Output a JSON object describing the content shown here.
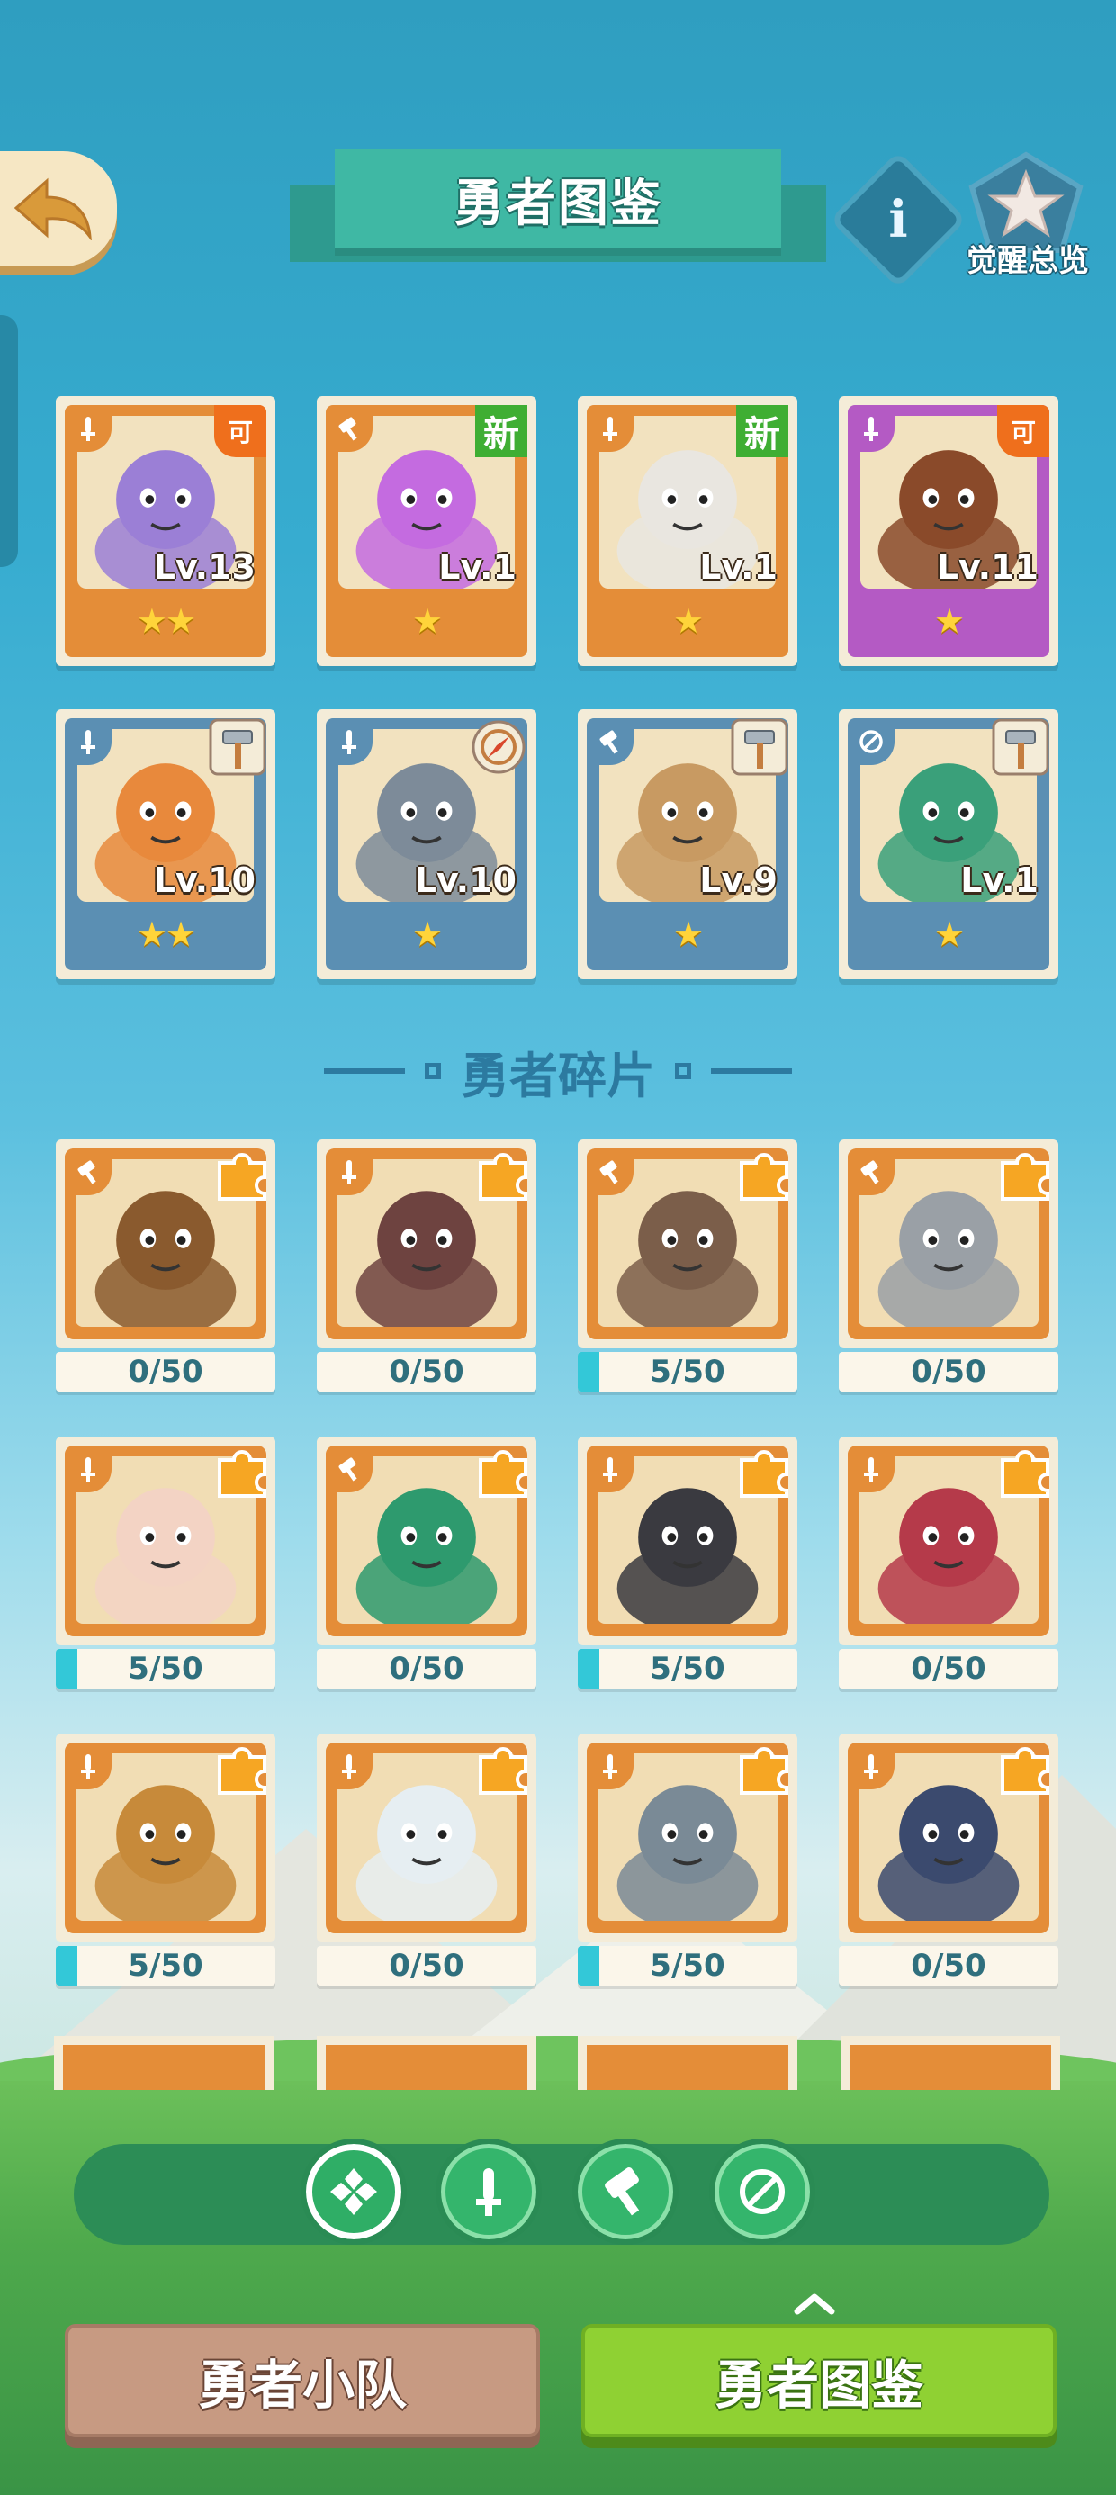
{
  "header": {
    "title": "勇者图鉴",
    "awaken_label": "觉醒总览",
    "info_icon": "info-icon",
    "back_icon": "back-arrow-icon",
    "awaken_icon": "star-crest-icon"
  },
  "owned_heroes": [
    {
      "role": "sword",
      "level": "Lv.13",
      "stars": "★★",
      "badge": "可",
      "frame": "orange",
      "portrait": "purple-elephant"
    },
    {
      "role": "hammer",
      "level": "Lv.1",
      "stars": "★",
      "badge": "新",
      "frame": "orange",
      "portrait": "purple-octopus"
    },
    {
      "role": "sword",
      "level": "Lv.1",
      "stars": "★",
      "badge": "新",
      "frame": "orange",
      "portrait": "white-wolf"
    },
    {
      "role": "sword",
      "level": "Lv.11",
      "stars": "★",
      "badge": "可",
      "frame": "purple",
      "portrait": "brown-dinosaur"
    },
    {
      "role": "sword",
      "level": "Lv.10",
      "stars": "★★",
      "badge": "hammer",
      "frame": "blue",
      "portrait": "fox-captain"
    },
    {
      "role": "sword",
      "level": "Lv.10",
      "stars": "★",
      "badge": "compass",
      "frame": "blue",
      "portrait": "grey-rabbit"
    },
    {
      "role": "hammer",
      "level": "Lv.9",
      "stars": "★",
      "badge": "hammer",
      "frame": "blue",
      "portrait": "hooded-girl"
    },
    {
      "role": "compass",
      "level": "Lv.1",
      "stars": "★",
      "badge": "hammer",
      "frame": "blue",
      "portrait": "green-frog"
    }
  ],
  "fragments_title": "勇者碎片",
  "fragments": [
    {
      "role": "hammer",
      "progress": "0/50",
      "fill": 0,
      "portrait": "lion"
    },
    {
      "role": "sword",
      "progress": "0/50",
      "fill": 0,
      "portrait": "armored-bull"
    },
    {
      "role": "hammer",
      "progress": "5/50",
      "fill": 0.1,
      "portrait": "bear-officer"
    },
    {
      "role": "hammer",
      "progress": "0/50",
      "fill": 0,
      "portrait": "gorilla"
    },
    {
      "role": "sword",
      "progress": "5/50",
      "fill": 0.1,
      "portrait": "white-rabbit"
    },
    {
      "role": "hammer",
      "progress": "0/50",
      "fill": 0,
      "portrait": "crocodile"
    },
    {
      "role": "sword",
      "progress": "5/50",
      "fill": 0.1,
      "portrait": "black-goat"
    },
    {
      "role": "sword",
      "progress": "0/50",
      "fill": 0,
      "portrait": "red-dragon"
    },
    {
      "role": "sword",
      "progress": "5/50",
      "fill": 0.1,
      "portrait": "lynx"
    },
    {
      "role": "sword",
      "progress": "0/50",
      "fill": 0,
      "portrait": "polar-bear"
    },
    {
      "role": "sword",
      "progress": "5/50",
      "fill": 0.1,
      "portrait": "wolf-parrot"
    },
    {
      "role": "sword",
      "progress": "0/50",
      "fill": 0,
      "portrait": "penguin"
    }
  ],
  "filters": [
    {
      "name": "all-filter-icon",
      "active": true
    },
    {
      "name": "sword-filter-icon",
      "active": false
    },
    {
      "name": "hammer-filter-icon",
      "active": false
    },
    {
      "name": "compass-filter-icon",
      "active": false
    }
  ],
  "bottom_nav": {
    "team_label": "勇者小队",
    "codex_label": "勇者图鉴"
  },
  "colors": {
    "frame_orange": "#e48d38",
    "frame_purple": "#b45ac4",
    "frame_blue": "#5b8fb3",
    "progress_fill": "#33c8d8",
    "codex_green": "#8fd133",
    "team_brown": "#c79a82"
  }
}
